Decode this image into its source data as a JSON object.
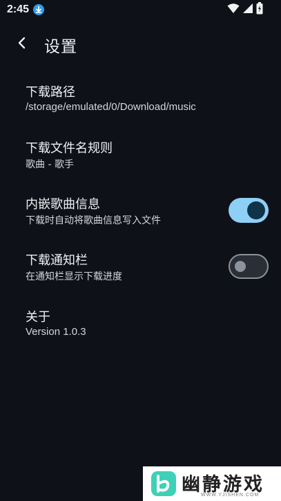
{
  "status_bar": {
    "time": "2:45"
  },
  "app_bar": {
    "title": "设置"
  },
  "settings": [
    {
      "title": "下载路径",
      "subtitle": "/storage/emulated/0/Download/music"
    },
    {
      "title": "下载文件名规则",
      "subtitle": "歌曲 - 歌手"
    },
    {
      "title": "内嵌歌曲信息",
      "subtitle": "下载时自动将歌曲信息写入文件",
      "toggle": "on"
    },
    {
      "title": "下载通知栏",
      "subtitle": "在通知栏显示下载进度",
      "toggle": "off"
    },
    {
      "title": "关于",
      "subtitle": "Version 1.0.3"
    }
  ],
  "watermark": {
    "text": "幽静游戏",
    "url": "WWW.YJISHEN.COM"
  },
  "colors": {
    "background": "#0e1218",
    "accent": "#8ecff5",
    "toggle_knob_on": "#0f3347",
    "download_badge": "#2d9cf0"
  },
  "icons": [
    "download-icon",
    "wifi-icon",
    "signal-icon",
    "battery-icon",
    "back-arrow-icon"
  ]
}
